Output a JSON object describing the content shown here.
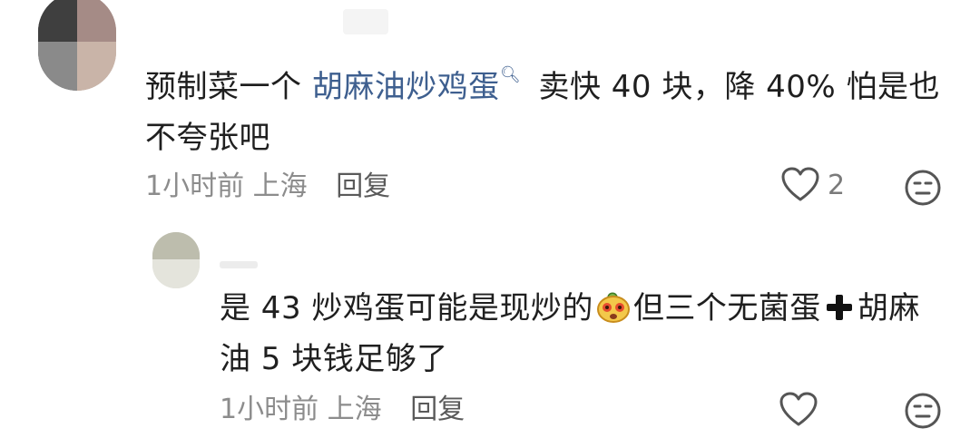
{
  "comment": {
    "text_before_link": "预制菜一个 ",
    "link_text": "胡麻油炒鸡蛋",
    "text_after_link": " 卖快 40 块，降 40% 怕是也不夸张吧",
    "time": "1小时前",
    "location": "上海",
    "reply_label": "回复",
    "like_count": "2"
  },
  "reply": {
    "text_part1": "是 43 炒鸡蛋可能是现炒的",
    "text_part2": "但三个无菌蛋",
    "text_part3": "胡麻油 5 块钱足够了",
    "time": "1小时前",
    "location": "上海",
    "reply_label": "回复"
  },
  "icons": {
    "search": "search-icon",
    "heart": "heart-icon",
    "face": "neutral-face-icon",
    "plus": "plus-icon",
    "sticker": "emoji-sticker"
  },
  "colors": {
    "link": "#3e5f8f",
    "meta": "#8c8c8c",
    "text": "#1f1f1f"
  }
}
